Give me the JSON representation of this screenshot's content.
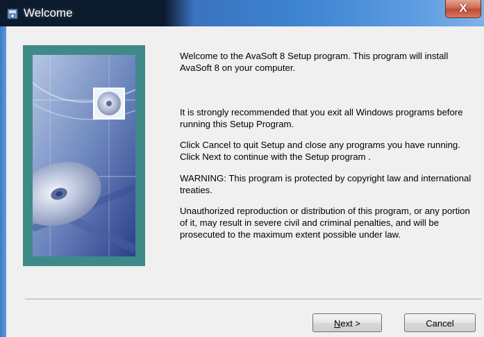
{
  "window": {
    "title": "Welcome",
    "close_glyph": "X",
    "title_icon": "setup-app-icon"
  },
  "banner": {
    "image": "cd-disc-artwork",
    "border_color": "#3f8a88"
  },
  "messages": [
    "Welcome to the AvaSoft 8 Setup program. This program will install AvaSoft 8 on your computer.",
    "It is strongly recommended that you exit all Windows programs before running this Setup Program.",
    "Click Cancel to quit Setup and close any programs you have running.  Click Next to continue with the Setup program .",
    "WARNING: This program is protected by copyright law and international treaties.",
    "Unauthorized reproduction or distribution of this program, or any portion of it, may result in severe civil and criminal penalties, and will be prosecuted to the maximum extent possible under law."
  ],
  "buttons": {
    "next_mnemonic": "N",
    "next_rest": "ext >",
    "cancel": "Cancel"
  }
}
